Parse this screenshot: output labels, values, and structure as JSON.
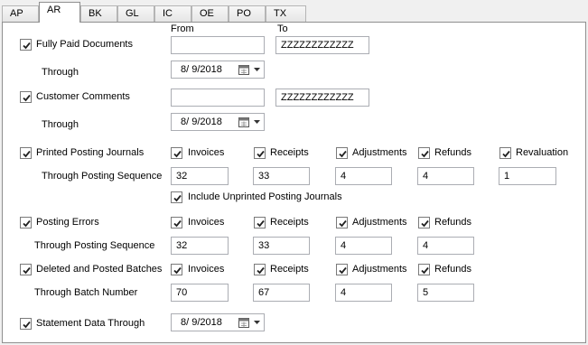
{
  "tabs": [
    "AP",
    "AR",
    "BK",
    "GL",
    "IC",
    "OE",
    "PO",
    "TX"
  ],
  "active_tab": "AR",
  "headers": {
    "from": "From",
    "to": "To"
  },
  "fully_paid": {
    "label": "Fully Paid Documents",
    "checked": true,
    "from": "",
    "to": "ZZZZZZZZZZZZ",
    "through_label": "Through",
    "through_date": "8/ 9/2018"
  },
  "customer_comments": {
    "label": "Customer Comments",
    "checked": true,
    "from": "",
    "to": "ZZZZZZZZZZZZ",
    "through_label": "Through",
    "through_date": "8/ 9/2018"
  },
  "printed_posting": {
    "label": "Printed Posting Journals",
    "checked": true,
    "options": [
      {
        "label": "Invoices",
        "checked": true,
        "value": "32"
      },
      {
        "label": "Receipts",
        "checked": true,
        "value": "33"
      },
      {
        "label": "Adjustments",
        "checked": true,
        "value": "4"
      },
      {
        "label": "Refunds",
        "checked": true,
        "value": "4"
      },
      {
        "label": "Revaluation",
        "checked": true,
        "value": "1"
      }
    ],
    "sequence_label": "Through Posting Sequence",
    "include_unprinted_label": "Include Unprinted Posting Journals",
    "include_unprinted_checked": true
  },
  "posting_errors": {
    "label": "Posting Errors",
    "checked": true,
    "options": [
      {
        "label": "Invoices",
        "checked": true,
        "value": "32"
      },
      {
        "label": "Receipts",
        "checked": true,
        "value": "33"
      },
      {
        "label": "Adjustments",
        "checked": true,
        "value": "4"
      },
      {
        "label": "Refunds",
        "checked": true,
        "value": "4"
      }
    ],
    "sequence_label": "Through Posting Sequence"
  },
  "deleted_batches": {
    "label": "Deleted and Posted Batches",
    "checked": true,
    "options": [
      {
        "label": "Invoices",
        "checked": true,
        "value": "70"
      },
      {
        "label": "Receipts",
        "checked": true,
        "value": "67"
      },
      {
        "label": "Adjustments",
        "checked": true,
        "value": "4"
      },
      {
        "label": "Refunds",
        "checked": true,
        "value": "5"
      }
    ],
    "batch_label": "Through Batch Number"
  },
  "statement": {
    "label": "Statement Data Through",
    "checked": true,
    "date": "8/ 9/2018"
  }
}
